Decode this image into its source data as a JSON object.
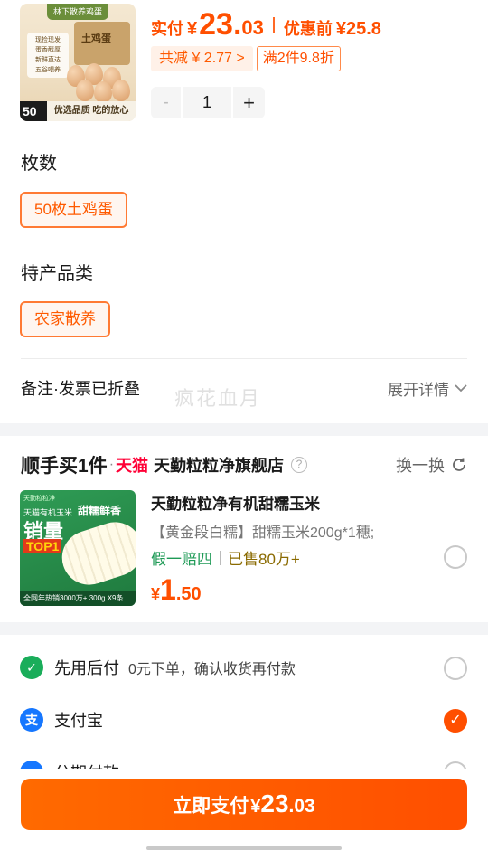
{
  "product": {
    "thumb_top_text": "林下散养鸡蛋",
    "thumb_box_text": "土鸡蛋",
    "thumb_tags": [
      "现捡现发",
      "蛋香醇厚",
      "新鲜直达",
      "五谷喂养"
    ],
    "thumb_badge": "50",
    "thumb_footer": "优选品质 吃的放心",
    "price_label": "实付",
    "price_symbol": "¥",
    "price_int": "23.",
    "price_dec": "03",
    "orig_label": "优惠前",
    "orig_price": "¥25.8",
    "discount_chip": "共减 ¥ 2.77 >",
    "discount_tag": "满2件9.8折",
    "quantity": "1",
    "minus_label": "-",
    "plus_label": "+"
  },
  "specs": {
    "count_title": "枚数",
    "count_option": "50枚土鸡蛋",
    "category_title": "特产品类",
    "category_option": "农家散养"
  },
  "notes": {
    "label": "备注·发票已折叠",
    "expand_label": "展开详情",
    "watermark": "疯花血月"
  },
  "buy_together": {
    "title": "顺手买1件",
    "dot": "·",
    "brand": "天猫",
    "store": "天勤粒粒净旗舰店",
    "swap_label": "换一换",
    "item": {
      "thumb_t1": "天勤粒粒净",
      "thumb_t2": "天猫有机玉米",
      "thumb_t3": "销量",
      "thumb_t4": "TOP1",
      "thumb_t5": "甜糯鲜香",
      "thumb_footer": "全网年热销3000万+ 300g X9条",
      "name": "天勤粒粒净有机甜糯玉米",
      "spec": "【黄金段白糯】甜糯玉米200g*1穗;",
      "tag_guarantee": "假一赔四",
      "tag_sold": "已售80万+",
      "price_symbol": "¥",
      "price_int": "1",
      "price_dec": ".50"
    }
  },
  "payment": {
    "methods": [
      {
        "icon": "credit-later-icon",
        "icon_glyph": "✓",
        "color": "#1aad5a",
        "name": "先用后付",
        "sub": "0元下单，确认收货再付款",
        "selected": false
      },
      {
        "icon": "alipay-icon",
        "icon_glyph": "支",
        "color": "#1677ff",
        "name": "支付宝",
        "sub": "",
        "selected": true
      },
      {
        "icon": "installment-icon",
        "icon_glyph": "◎",
        "color": "#1677ff",
        "name": "分期付款",
        "sub": "",
        "selected": false
      }
    ]
  },
  "pay_button": {
    "label": "立即支付",
    "symbol": "¥",
    "int": "23",
    "dec": ".03"
  },
  "colors": {
    "accent": "#ff4f00",
    "tmall": "#ff0036",
    "green": "#1e9a56",
    "alipay": "#1677ff"
  }
}
